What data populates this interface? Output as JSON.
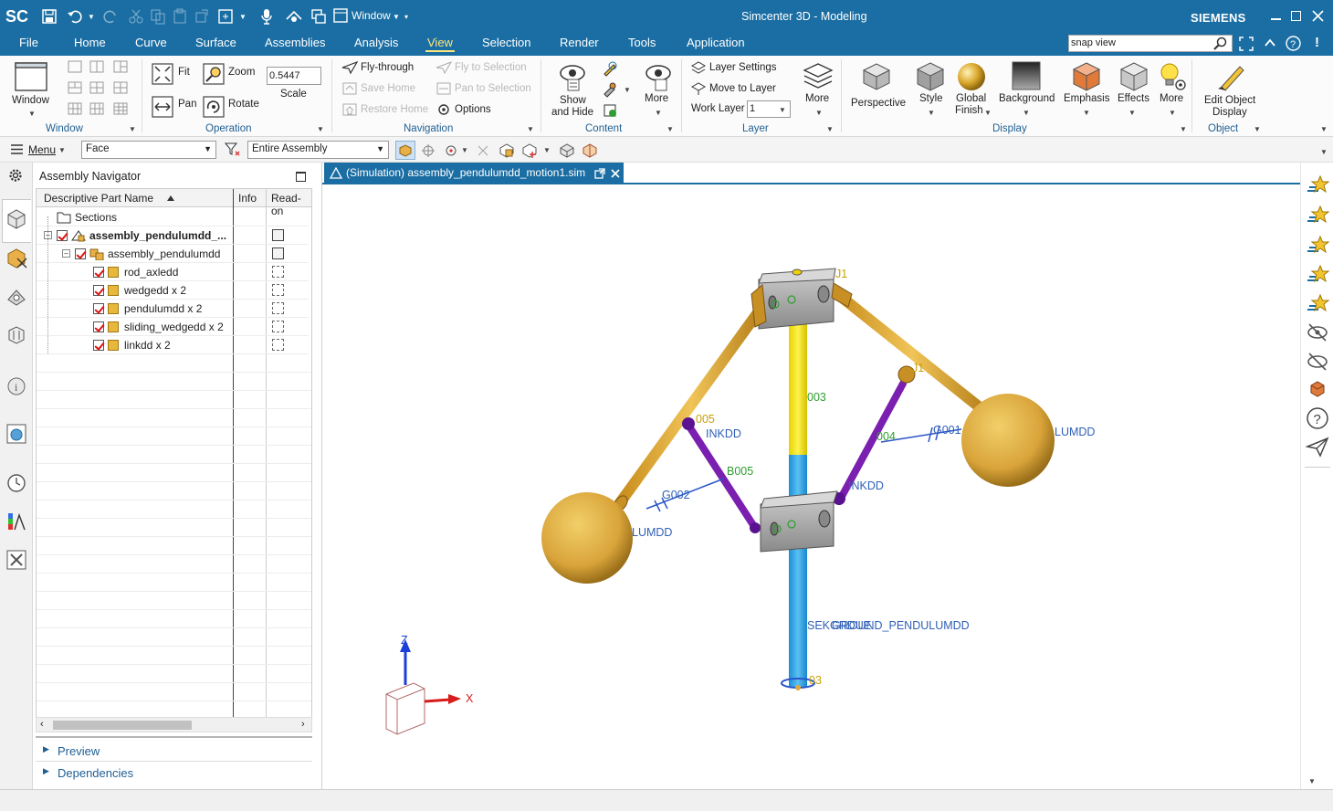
{
  "titlebar": {
    "app_logo": "SC",
    "window_menu": "Window",
    "title": "Simcenter 3D - Modeling",
    "brand": "SIEMENS"
  },
  "menubar": {
    "tabs": [
      "File",
      "Home",
      "Curve",
      "Surface",
      "Assemblies",
      "Analysis",
      "View",
      "Selection",
      "Render",
      "Tools",
      "Application"
    ],
    "active_tab": "View",
    "search_value": "snap view"
  },
  "ribbon": {
    "window_group": {
      "window_label": "Window",
      "group": "Window"
    },
    "operation_group": {
      "fit": "Fit",
      "zoom": "Zoom",
      "scale_value": "0.5447",
      "scale_label": "Scale",
      "pan": "Pan",
      "rotate": "Rotate",
      "group": "Operation"
    },
    "navigation_group": {
      "fly_through": "Fly-through",
      "fly_to_selection": "Fly to Selection",
      "save_home": "Save Home",
      "pan_to_selection": "Pan to Selection",
      "restore_home": "Restore Home",
      "options": "Options",
      "group": "Navigation"
    },
    "content_group": {
      "show_and_hide_1": "Show",
      "show_and_hide_2": "and Hide",
      "more": "More",
      "group": "Content"
    },
    "layer_group": {
      "layer_settings": "Layer Settings",
      "move_to_layer": "Move to Layer",
      "work_layer": "Work Layer",
      "work_layer_value": "1",
      "more": "More",
      "group": "Layer"
    },
    "display_group": {
      "perspective": "Perspective",
      "style": "Style",
      "global_finish_1": "Global",
      "global_finish_2": "Finish",
      "background": "Background",
      "emphasis": "Emphasis",
      "effects": "Effects",
      "more": "More",
      "group": "Display"
    },
    "object_group": {
      "edit_object_display_1": "Edit Object",
      "edit_object_display_2": "Display",
      "group": "Object"
    }
  },
  "toolbar2": {
    "menu": "Menu",
    "selection_filter": "Face",
    "scope": "Entire Assembly"
  },
  "navigator": {
    "title": "Assembly Navigator",
    "columns": [
      "Descriptive Part Name",
      "Info",
      "Read-on"
    ],
    "rows": [
      {
        "label": "Sections",
        "indent": 0
      },
      {
        "label": "assembly_pendulumdd_...",
        "indent": 0
      },
      {
        "label": "assembly_pendulumdd",
        "indent": 1
      },
      {
        "label": "rod_axledd",
        "indent": 2
      },
      {
        "label": "wedgedd x 2",
        "indent": 2
      },
      {
        "label": "pendulumdd x 2",
        "indent": 2
      },
      {
        "label": "sliding_wedgedd x 2",
        "indent": 2
      },
      {
        "label": "linkdd x 2",
        "indent": 2
      }
    ],
    "preview": "Preview",
    "dependencies": "Dependencies"
  },
  "viewport": {
    "doc_tab": "(Simulation) assembly_pendulumdd_motion1.sim",
    "labels": {
      "l003": "003",
      "l005": "005",
      "inkdd_left": "INKDD",
      "b005": "B005",
      "g002": "G002",
      "umdd_left": "LUMDD",
      "l004": "004",
      "g001": "G001",
      "umdd_right": "LUMDD",
      "inkdd_right": "INKDD",
      "ground": "GROUND_PENDULUMDD",
      "ground_prefix": "SEKGRDUE",
      "j1": "J1",
      "j2": "J1",
      "j3": "03",
      "axis_z": "Z",
      "axis_x": "X"
    }
  },
  "colors": {
    "accent": "#1b6ea3",
    "rod_yellow": "#ffee00",
    "rod_blue": "#29a3e6",
    "gold": "#e0a93d",
    "link_purple": "#7a1fb0",
    "label_blue": "#3060b8",
    "label_green": "#2e9e2e"
  }
}
